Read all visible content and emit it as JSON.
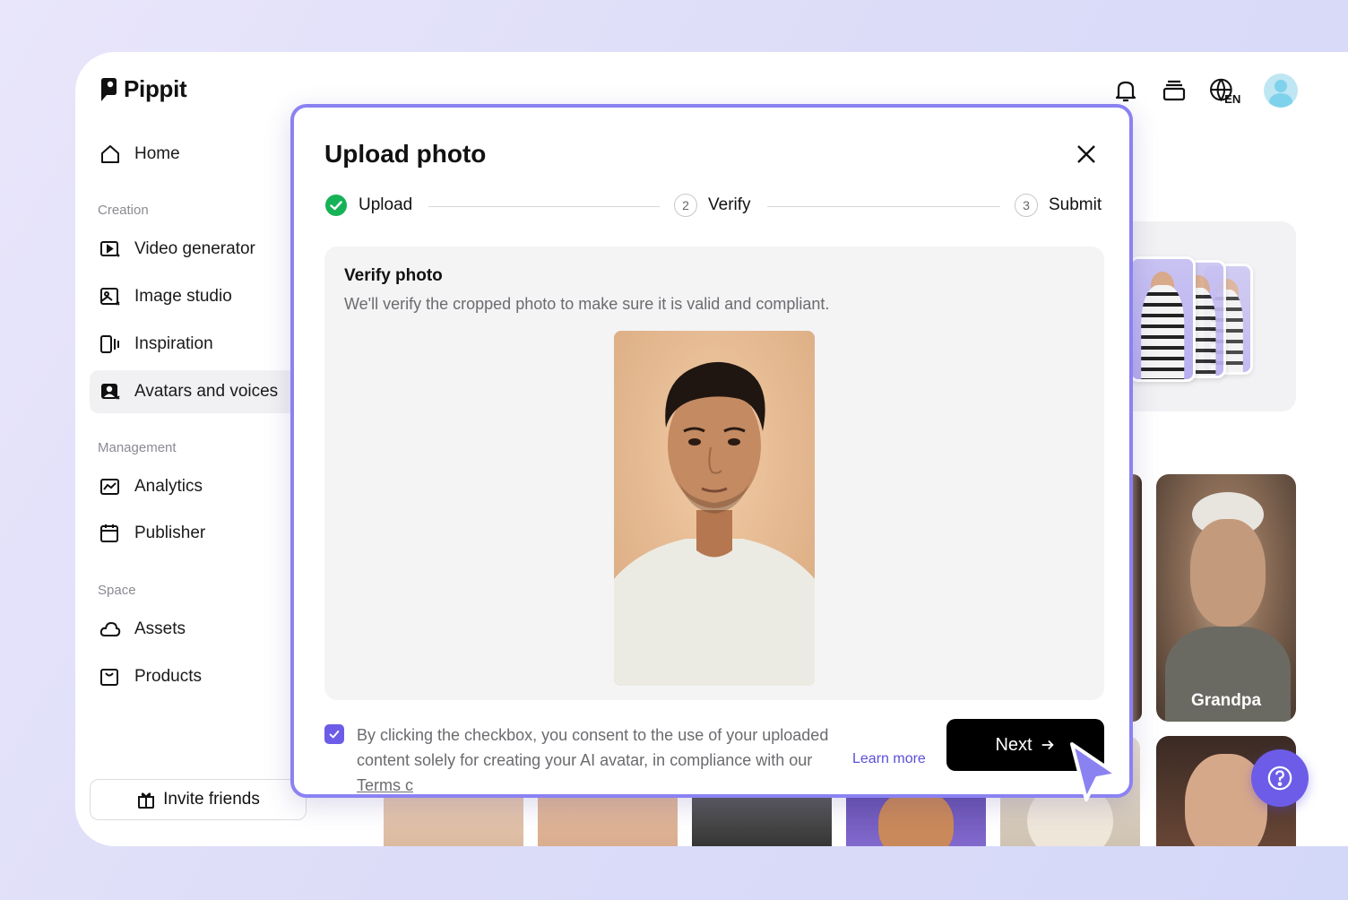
{
  "brand": {
    "name": "Pippit"
  },
  "sidebar": {
    "home": "Home",
    "sections": [
      {
        "label": "Creation",
        "items": [
          "Video generator",
          "Image studio",
          "Inspiration",
          "Avatars and voices"
        ]
      },
      {
        "label": "Management",
        "items": [
          "Analytics",
          "Publisher"
        ]
      },
      {
        "label": "Space",
        "items": [
          "Assets",
          "Products"
        ]
      }
    ],
    "active_item": "Avatars and voices",
    "invite_label": "Invite friends"
  },
  "header": {
    "language": "EN",
    "icons": [
      "bell-icon",
      "stack-icon",
      "globe-icon",
      "avatar"
    ]
  },
  "background_tiles": {
    "grandpa_label": "Grandpa"
  },
  "modal": {
    "title": "Upload photo",
    "steps": [
      {
        "num": "",
        "label": "Upload",
        "state": "done"
      },
      {
        "num": "2",
        "label": "Verify",
        "state": "current"
      },
      {
        "num": "3",
        "label": "Submit",
        "state": "pending"
      }
    ],
    "verify_title": "Verify photo",
    "verify_desc": "We'll verify the cropped photo to make sure it is valid and compliant.",
    "consent_text_1": "By clicking the checkbox, you consent to the use of your uploaded content solely for creating your AI avatar, in compliance with our ",
    "consent_terms": "Terms c",
    "learn_more": "Learn more",
    "next_label": "Next",
    "consent_checked": true
  },
  "colors": {
    "accent": "#6c5ce7",
    "modal_border": "#8b82f2",
    "success": "#16b257"
  }
}
